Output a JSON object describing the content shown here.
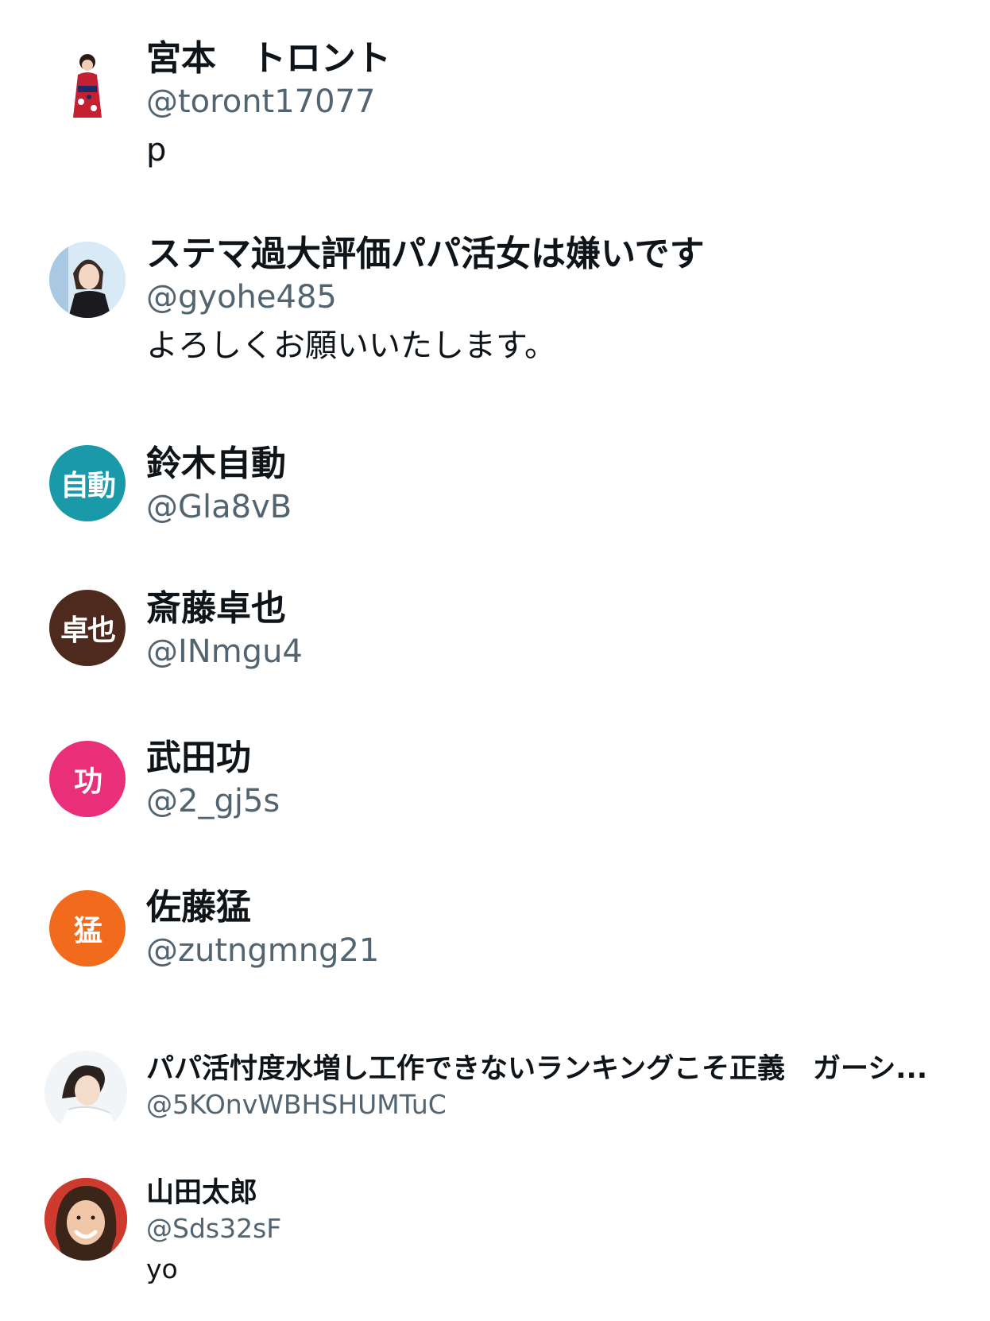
{
  "users": [
    {
      "name": "宮本　トロント",
      "handle": "@toront17077",
      "bio": "p",
      "avatar": {
        "type": "photo",
        "icon": "kimono-person-avatar"
      }
    },
    {
      "name": "ステマ過大評価パパ活女は嫌いです",
      "handle": "@gyohe485",
      "bio": "よろしくお願いいたします。",
      "avatar": {
        "type": "photo",
        "icon": "woman-photo-avatar"
      }
    },
    {
      "name": "鈴木自動",
      "handle": "@Gla8vB",
      "avatar": {
        "type": "initials",
        "text": "自動",
        "color": "#1a9aa8"
      }
    },
    {
      "name": "斎藤卓也",
      "handle": "@INmgu4",
      "avatar": {
        "type": "initials",
        "text": "卓也",
        "color": "#4e2a1e"
      }
    },
    {
      "name": "武田功",
      "handle": "@2_gj5s",
      "avatar": {
        "type": "initials",
        "text": "功",
        "color": "#ea2f7a"
      }
    },
    {
      "name": "佐藤猛",
      "handle": "@zutngmng21",
      "avatar": {
        "type": "initials",
        "text": "猛",
        "color": "#f26b1d"
      }
    },
    {
      "name": "パパ活忖度水増し工作できないランキングこそ正義　ガーシ...",
      "handle": "@5KOnvWBHSHUMTuC",
      "avatar": {
        "type": "photo",
        "icon": "woman-photo-avatar"
      }
    },
    {
      "name": "山田太郎",
      "handle": "@Sds32sF",
      "bio": "yo",
      "avatar": {
        "type": "photo",
        "icon": "smiling-woman-photo-avatar"
      }
    }
  ]
}
